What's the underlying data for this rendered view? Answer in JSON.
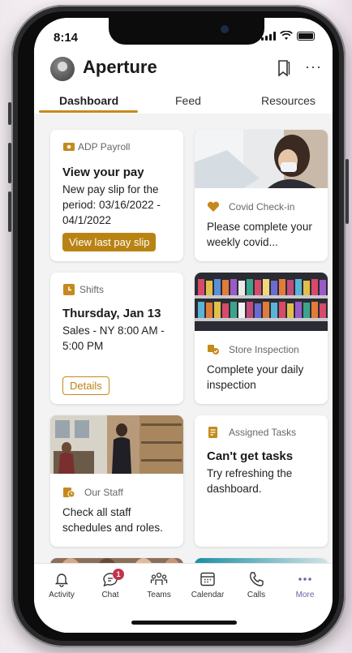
{
  "status": {
    "time": "8:14"
  },
  "app": {
    "title": "Aperture"
  },
  "tabs": [
    {
      "label": "Dashboard"
    },
    {
      "label": "Feed"
    },
    {
      "label": "Resources"
    }
  ],
  "cards": {
    "payroll": {
      "label": "ADP Payroll",
      "title": "View your pay",
      "body": "New pay slip for the period: 03/16/2022 - 04/1/2022",
      "button": "View last pay slip"
    },
    "covid": {
      "label": "Covid Check-in",
      "body": "Please complete your weekly covid..."
    },
    "shifts": {
      "label": "Shifts",
      "title": "Thursday, Jan 13",
      "body": "Sales - NY 8:00 AM - 5:00 PM",
      "button": "Details"
    },
    "store": {
      "label": "Store Inspection",
      "body": "Complete your daily inspection"
    },
    "staff": {
      "label": "Our Staff",
      "body": "Check all staff schedules and roles."
    },
    "tasks": {
      "label": "Assigned Tasks",
      "title": "Can't get tasks",
      "body": "Try refreshing the dashboard."
    }
  },
  "nav": [
    {
      "label": "Activity",
      "icon": "bell-icon"
    },
    {
      "label": "Chat",
      "icon": "chat-icon",
      "badge": "1"
    },
    {
      "label": "Teams",
      "icon": "teams-icon"
    },
    {
      "label": "Calendar",
      "icon": "calendar-icon"
    },
    {
      "label": "Calls",
      "icon": "phone-icon"
    },
    {
      "label": "More",
      "icon": "more-icon"
    }
  ],
  "colors": {
    "accent": "#b98314",
    "teams_purple": "#6264a7",
    "badge": "#c4314b"
  }
}
